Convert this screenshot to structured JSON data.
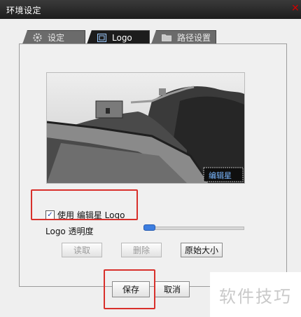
{
  "window": {
    "title": "环境设定",
    "close_glyph": "✕"
  },
  "tabs": [
    {
      "label": "设定",
      "icon": "gear-icon",
      "active": false
    },
    {
      "label": "Logo",
      "icon": "image-icon",
      "active": true
    },
    {
      "label": "路径设置",
      "icon": "folder-icon",
      "active": false
    }
  ],
  "logo_panel": {
    "preview_badge": "编辑星",
    "use_logo_checkbox": {
      "label": "使用 编辑星 Logo",
      "checked": true
    },
    "transparency": {
      "label": "Logo 透明度",
      "value_fraction": 0.0
    },
    "buttons": {
      "read": "读取",
      "delete": "删除",
      "original_size": "原始大小"
    }
  },
  "footer": {
    "save": "保存",
    "cancel": "取消"
  },
  "watermark": {
    "text": "软件技巧"
  },
  "colors": {
    "highlight": "#d8302b",
    "titlebar": "#1d1d1d",
    "active_tab": "#1c1c1c"
  }
}
